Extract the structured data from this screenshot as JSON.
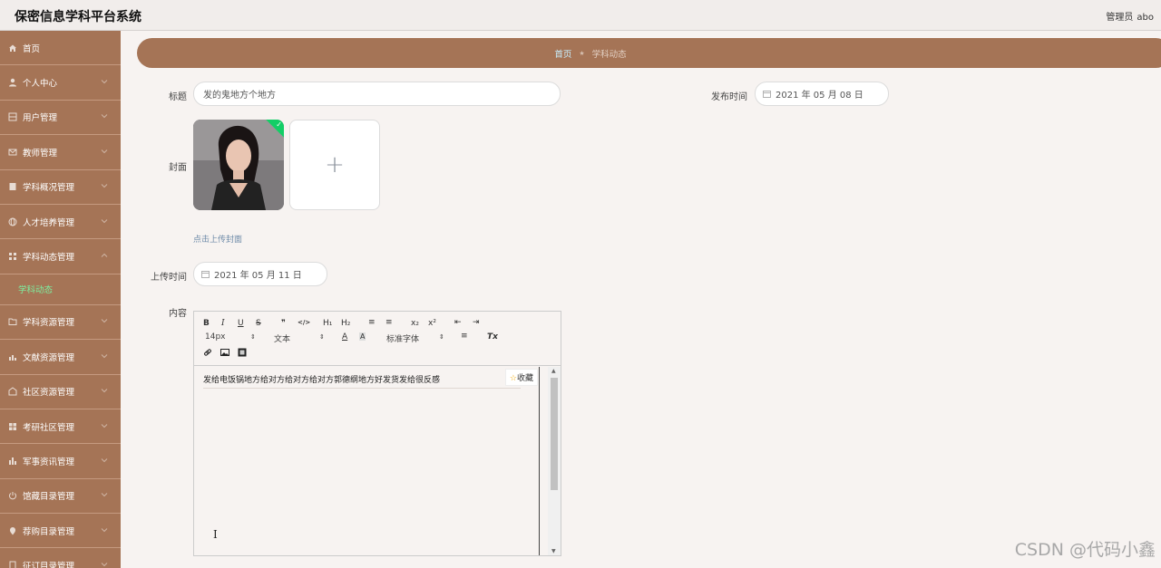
{
  "app": {
    "title": "保密信息学科平台系统"
  },
  "user": {
    "role": "管理员",
    "name": "abo"
  },
  "sidebar": {
    "items": [
      {
        "label": "首页",
        "icon": "home-icon"
      },
      {
        "label": "个人中心",
        "icon": "person-icon"
      },
      {
        "label": "用户管理",
        "icon": "grid-icon"
      },
      {
        "label": "教师管理",
        "icon": "mail-icon"
      },
      {
        "label": "学科概况管理",
        "icon": "book-icon"
      },
      {
        "label": "人才培养管理",
        "icon": "globe-icon"
      },
      {
        "label": "学科动态管理",
        "icon": "apps-icon"
      },
      {
        "label": "学科资源管理",
        "icon": "folder-icon"
      },
      {
        "label": "文献资源管理",
        "icon": "chart-icon"
      },
      {
        "label": "社区资源管理",
        "icon": "community-icon"
      },
      {
        "label": "考研社区管理",
        "icon": "modules-icon"
      },
      {
        "label": "军事资讯管理",
        "icon": "bars-icon"
      },
      {
        "label": "馆藏目录管理",
        "icon": "power-icon"
      },
      {
        "label": "荐购目录管理",
        "icon": "pin-icon"
      },
      {
        "label": "征订目录管理",
        "icon": "doc-icon"
      }
    ],
    "sub_item": "学科动态"
  },
  "breadcrumb": {
    "home": "首页",
    "current": "学科动态"
  },
  "form": {
    "title_label": "标题",
    "title_value": "发的鬼地方个地方",
    "publish_label": "发布时间",
    "publish_value": "2021 年 05 月 08 日",
    "cover_label": "封面",
    "upload_hint": "点击上传封面",
    "upload_time_label": "上传时间",
    "upload_time_value": "2021 年 05 月 11 日",
    "content_label": "内容"
  },
  "editor": {
    "toolbar": {
      "bold": "B",
      "italic": "I",
      "underline": "U",
      "strike": "S",
      "quote": "❞",
      "code": "</>",
      "h1": "H₁",
      "h2": "H₂",
      "ol": "≡",
      "ul": "≡",
      "sub": "x₂",
      "sup": "x²",
      "indent_out": "⇤",
      "indent_in": "⇥",
      "font_size": "14px",
      "text_style": "文本",
      "font_color": "A",
      "bg_color": "A",
      "font_family": "标准字体",
      "align": "≡",
      "clear": "Tx"
    },
    "content": "发给电饭锅地方给对方给对方给对方郭德纲地方好发货发给很反感",
    "fav_label": "收藏"
  },
  "watermark": "CSDN @代码小鑫"
}
